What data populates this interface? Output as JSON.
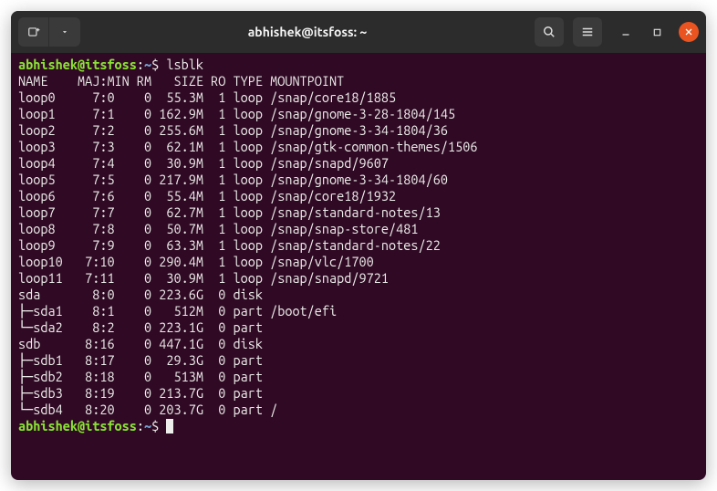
{
  "titlebar": {
    "title": "abhishek@itsfoss: ~"
  },
  "prompt": {
    "userhost": "abhishek@itsfoss",
    "sep1": ":",
    "path": "~",
    "sep2": "$"
  },
  "command": "lsblk",
  "columns": {
    "name": "NAME",
    "majmin": "MAJ:MIN",
    "rm": "RM",
    "size": "SIZE",
    "ro": "RO",
    "type": "TYPE",
    "mountpoint": "MOUNTPOINT"
  },
  "rows": [
    {
      "tree": "",
      "name": "loop0",
      "majmin": "7:0",
      "rm": "0",
      "size": "55.3M",
      "ro": "1",
      "type": "loop",
      "mountpoint": "/snap/core18/1885"
    },
    {
      "tree": "",
      "name": "loop1",
      "majmin": "7:1",
      "rm": "0",
      "size": "162.9M",
      "ro": "1",
      "type": "loop",
      "mountpoint": "/snap/gnome-3-28-1804/145"
    },
    {
      "tree": "",
      "name": "loop2",
      "majmin": "7:2",
      "rm": "0",
      "size": "255.6M",
      "ro": "1",
      "type": "loop",
      "mountpoint": "/snap/gnome-3-34-1804/36"
    },
    {
      "tree": "",
      "name": "loop3",
      "majmin": "7:3",
      "rm": "0",
      "size": "62.1M",
      "ro": "1",
      "type": "loop",
      "mountpoint": "/snap/gtk-common-themes/1506"
    },
    {
      "tree": "",
      "name": "loop4",
      "majmin": "7:4",
      "rm": "0",
      "size": "30.9M",
      "ro": "1",
      "type": "loop",
      "mountpoint": "/snap/snapd/9607"
    },
    {
      "tree": "",
      "name": "loop5",
      "majmin": "7:5",
      "rm": "0",
      "size": "217.9M",
      "ro": "1",
      "type": "loop",
      "mountpoint": "/snap/gnome-3-34-1804/60"
    },
    {
      "tree": "",
      "name": "loop6",
      "majmin": "7:6",
      "rm": "0",
      "size": "55.4M",
      "ro": "1",
      "type": "loop",
      "mountpoint": "/snap/core18/1932"
    },
    {
      "tree": "",
      "name": "loop7",
      "majmin": "7:7",
      "rm": "0",
      "size": "62.7M",
      "ro": "1",
      "type": "loop",
      "mountpoint": "/snap/standard-notes/13"
    },
    {
      "tree": "",
      "name": "loop8",
      "majmin": "7:8",
      "rm": "0",
      "size": "50.7M",
      "ro": "1",
      "type": "loop",
      "mountpoint": "/snap/snap-store/481"
    },
    {
      "tree": "",
      "name": "loop9",
      "majmin": "7:9",
      "rm": "0",
      "size": "63.3M",
      "ro": "1",
      "type": "loop",
      "mountpoint": "/snap/standard-notes/22"
    },
    {
      "tree": "",
      "name": "loop10",
      "majmin": "7:10",
      "rm": "0",
      "size": "290.4M",
      "ro": "1",
      "type": "loop",
      "mountpoint": "/snap/vlc/1700"
    },
    {
      "tree": "",
      "name": "loop11",
      "majmin": "7:11",
      "rm": "0",
      "size": "30.9M",
      "ro": "1",
      "type": "loop",
      "mountpoint": "/snap/snapd/9721"
    },
    {
      "tree": "",
      "name": "sda",
      "majmin": "8:0",
      "rm": "0",
      "size": "223.6G",
      "ro": "0",
      "type": "disk",
      "mountpoint": ""
    },
    {
      "tree": "├─",
      "name": "sda1",
      "majmin": "8:1",
      "rm": "0",
      "size": "512M",
      "ro": "0",
      "type": "part",
      "mountpoint": "/boot/efi"
    },
    {
      "tree": "└─",
      "name": "sda2",
      "majmin": "8:2",
      "rm": "0",
      "size": "223.1G",
      "ro": "0",
      "type": "part",
      "mountpoint": ""
    },
    {
      "tree": "",
      "name": "sdb",
      "majmin": "8:16",
      "rm": "0",
      "size": "447.1G",
      "ro": "0",
      "type": "disk",
      "mountpoint": ""
    },
    {
      "tree": "├─",
      "name": "sdb1",
      "majmin": "8:17",
      "rm": "0",
      "size": "29.3G",
      "ro": "0",
      "type": "part",
      "mountpoint": ""
    },
    {
      "tree": "├─",
      "name": "sdb2",
      "majmin": "8:18",
      "rm": "0",
      "size": "513M",
      "ro": "0",
      "type": "part",
      "mountpoint": ""
    },
    {
      "tree": "├─",
      "name": "sdb3",
      "majmin": "8:19",
      "rm": "0",
      "size": "213.7G",
      "ro": "0",
      "type": "part",
      "mountpoint": ""
    },
    {
      "tree": "└─",
      "name": "sdb4",
      "majmin": "8:20",
      "rm": "0",
      "size": "203.7G",
      "ro": "0",
      "type": "part",
      "mountpoint": "/"
    }
  ]
}
